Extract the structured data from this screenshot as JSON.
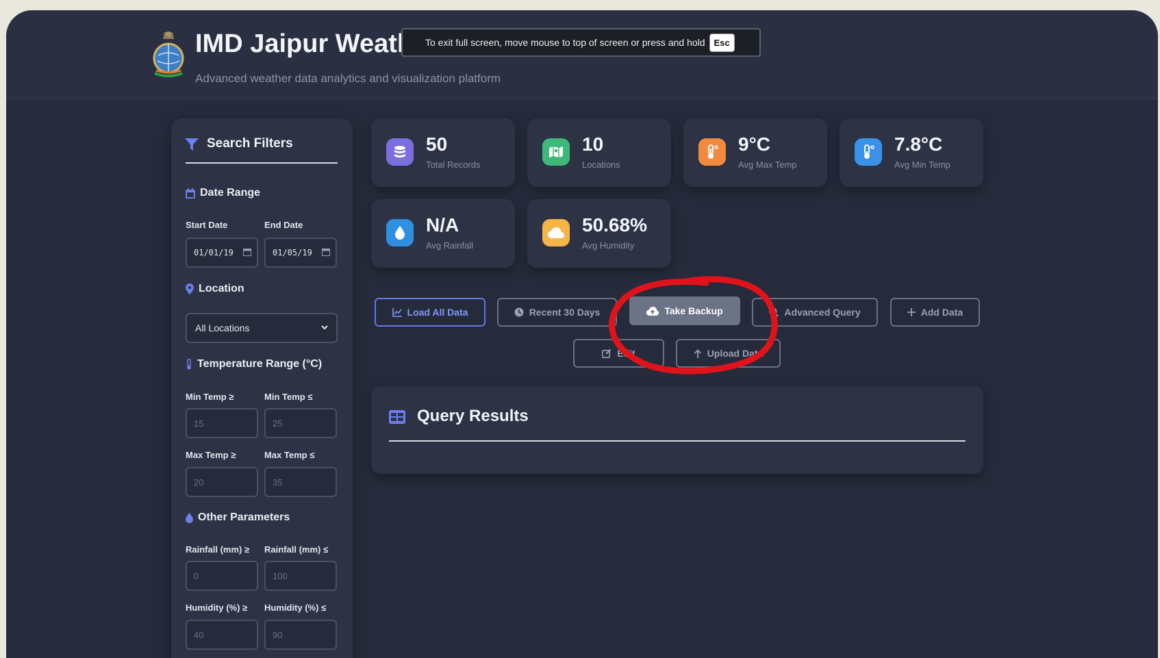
{
  "header": {
    "title": "IMD Jaipur Weather Dashboard",
    "subtitle": "Advanced weather data analytics and visualization platform"
  },
  "fullscreen_notice": {
    "text": "To exit full screen, move mouse to top of screen or press and hold",
    "key": "Esc"
  },
  "sidebar": {
    "title": "Search Filters",
    "date_range": {
      "heading": "Date Range",
      "start_label": "Start Date",
      "end_label": "End Date",
      "start_value": "01/01/19",
      "end_value": "01/05/19"
    },
    "location": {
      "heading": "Location",
      "selected": "All Locations"
    },
    "temperature": {
      "heading": "Temperature Range (°C)",
      "min_ge_label": "Min Temp ≥",
      "min_le_label": "Min Temp ≤",
      "max_ge_label": "Max Temp ≥",
      "max_le_label": "Max Temp ≤",
      "min_ge_placeholder": "15",
      "min_le_placeholder": "25",
      "max_ge_placeholder": "20",
      "max_le_placeholder": "35"
    },
    "other": {
      "heading": "Other Parameters",
      "rain_ge_label": "Rainfall (mm) ≥",
      "rain_le_label": "Rainfall (mm) ≤",
      "hum_ge_label": "Humidity (%) ≥",
      "hum_le_label": "Humidity (%) ≤",
      "rain_ge_placeholder": "0",
      "rain_le_placeholder": "100",
      "hum_ge_placeholder": "40",
      "hum_le_placeholder": "90"
    }
  },
  "stats": [
    {
      "value": "50",
      "label": "Total Records",
      "icon": "database-icon",
      "color": "#7b6fe0"
    },
    {
      "value": "10",
      "label": "Locations",
      "icon": "map-icon",
      "color": "#3cb878"
    },
    {
      "value": "9°C",
      "label": "Avg Max Temp",
      "icon": "thermometer-hot-icon",
      "color": "#f08a3c"
    },
    {
      "value": "7.8°C",
      "label": "Avg Min Temp",
      "icon": "thermometer-cold-icon",
      "color": "#3a92e8"
    },
    {
      "value": "N/A",
      "label": "Avg Rainfall",
      "icon": "droplet-icon",
      "color": "#2f8fe0"
    },
    {
      "value": "50.68%",
      "label": "Avg Humidity",
      "icon": "cloud-icon",
      "color": "#f5b547"
    }
  ],
  "actions": {
    "load_all": "Load All Data",
    "recent_30": "Recent 30 Days",
    "backup": "Take Backup",
    "advanced_query": "Advanced Query",
    "add_data": "Add Data",
    "edit": "Edit",
    "upload": "Upload Data"
  },
  "results": {
    "title": "Query Results"
  },
  "annotation_color": "#e0131a"
}
